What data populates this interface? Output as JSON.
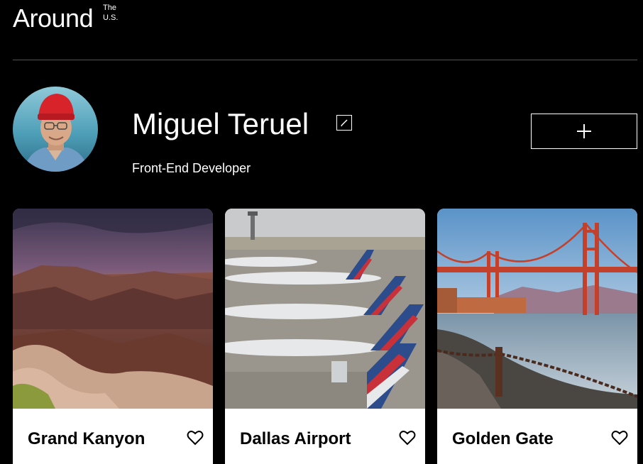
{
  "header": {
    "logo_text": "Around",
    "logo_superscript": "The U.S."
  },
  "profile": {
    "name": "Miguel Teruel",
    "job": "Front-End Developer",
    "avatar_icon": "profile-photo",
    "edit_icon": "pencil-icon",
    "add_icon": "plus-icon"
  },
  "cards": [
    {
      "title": "Grand Kanyon",
      "image": "canyon-sunset-photo",
      "like_icon": "heart-icon"
    },
    {
      "title": "Dallas Airport",
      "image": "airport-planes-photo",
      "like_icon": "heart-icon"
    },
    {
      "title": "Golden Gate",
      "image": "golden-gate-bridge-photo",
      "like_icon": "heart-icon"
    }
  ],
  "colors": {
    "background": "#000000",
    "text": "#ffffff",
    "card_background": "#ffffff",
    "card_text": "#000000",
    "divider": "#545454"
  }
}
